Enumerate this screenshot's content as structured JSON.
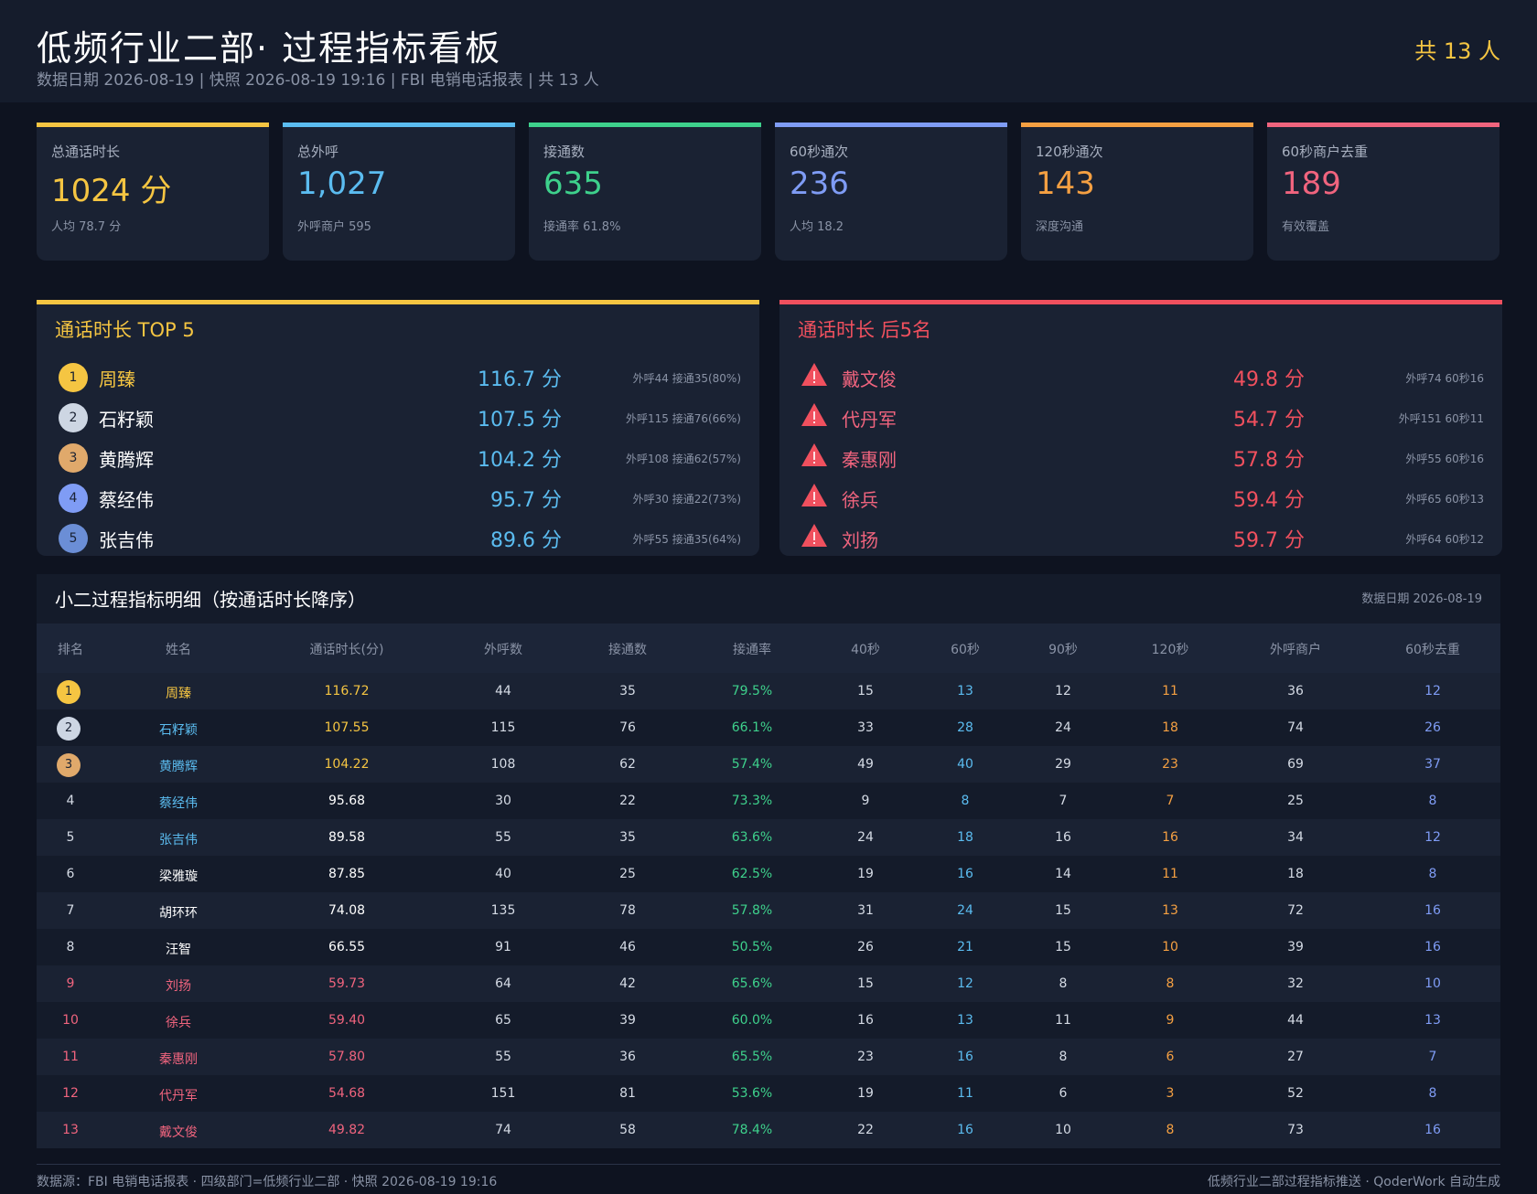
{
  "header": {
    "title": "低频行业二部· 过程指标看板",
    "subtitle": "数据日期 2026-08-19 | 快照 2026-08-19 19:16 | FBI 电销电话报表 | 共 13 人",
    "count": "共 13 人"
  },
  "kpis": [
    {
      "label": "总通话时长",
      "value": "1024 分",
      "note": "人均 78.7 分",
      "color": "#f5c542"
    },
    {
      "label": "总外呼",
      "value": "1,027",
      "note": "外呼商户 595",
      "color": "#5bbcf0"
    },
    {
      "label": "接通数",
      "value": "635",
      "note": "接通率 61.8%",
      "color": "#3ed18c"
    },
    {
      "label": "60秒通次",
      "value": "236",
      "note": "人均 18.2",
      "color": "#7f9cf5"
    },
    {
      "label": "120秒通次",
      "value": "143",
      "note": "深度沟通",
      "color": "#f5a042"
    },
    {
      "label": "60秒商户去重",
      "value": "189",
      "note": "有效覆盖",
      "color": "#f0647e"
    }
  ],
  "top5": {
    "title": "通话时长 TOP 5",
    "color": "#f5c542",
    "rows": [
      {
        "rank": "1",
        "name": "周臻",
        "mins": "116.7 分",
        "meta": "外呼44 接通35(80%)",
        "medal": "#f5c542",
        "namecolor": "#f5c542"
      },
      {
        "rank": "2",
        "name": "石籽颖",
        "mins": "107.5 分",
        "meta": "外呼115 接通76(66%)",
        "medal": "#cdd6e3",
        "namecolor": "#ffffff"
      },
      {
        "rank": "3",
        "name": "黄腾辉",
        "mins": "104.2 分",
        "meta": "外呼108 接通62(57%)",
        "medal": "#e0a96b",
        "namecolor": "#ffffff"
      },
      {
        "rank": "4",
        "name": "蔡经伟",
        "mins": "95.7 分",
        "meta": "外呼30 接通22(73%)",
        "medal": "#7f9cf5",
        "namecolor": "#ffffff"
      },
      {
        "rank": "5",
        "name": "张吉伟",
        "mins": "89.6 分",
        "meta": "外呼55 接通35(64%)",
        "medal": "#6b8ed6",
        "namecolor": "#ffffff"
      }
    ]
  },
  "bottom5": {
    "title": "通话时长 后5名",
    "color": "#f0505e",
    "rows": [
      {
        "name": "戴文俊",
        "mins": "49.8 分",
        "meta": "外呼74 60秒16"
      },
      {
        "name": "代丹军",
        "mins": "54.7 分",
        "meta": "外呼151 60秒11"
      },
      {
        "name": "秦惠刚",
        "mins": "57.8 分",
        "meta": "外呼55 60秒16"
      },
      {
        "name": "徐兵",
        "mins": "59.4 分",
        "meta": "外呼65 60秒13"
      },
      {
        "name": "刘扬",
        "mins": "59.7 分",
        "meta": "外呼64 60秒12"
      }
    ]
  },
  "detail": {
    "title": "小二过程指标明细（按通话时长降序）",
    "date": "数据日期 2026-08-19",
    "columns": [
      "排名",
      "姓名",
      "通话时长(分)",
      "外呼数",
      "接通数",
      "接通率",
      "40秒",
      "60秒",
      "90秒",
      "120秒",
      "外呼商户",
      "60秒去重"
    ],
    "rows": [
      {
        "rank": "1",
        "name": "周臻",
        "mins": "116.72",
        "calls": "44",
        "conn": "35",
        "rate": "79.5%",
        "s40": "15",
        "s60": "13",
        "s90": "12",
        "s120": "11",
        "merch": "36",
        "dedup": "12",
        "tier": "gold"
      },
      {
        "rank": "2",
        "name": "石籽颖",
        "mins": "107.55",
        "calls": "115",
        "conn": "76",
        "rate": "66.1%",
        "s40": "33",
        "s60": "28",
        "s90": "24",
        "s120": "18",
        "merch": "74",
        "dedup": "26",
        "tier": "silver"
      },
      {
        "rank": "3",
        "name": "黄腾辉",
        "mins": "104.22",
        "calls": "108",
        "conn": "62",
        "rate": "57.4%",
        "s40": "49",
        "s60": "40",
        "s90": "29",
        "s120": "23",
        "merch": "69",
        "dedup": "37",
        "tier": "bronze"
      },
      {
        "rank": "4",
        "name": "蔡经伟",
        "mins": "95.68",
        "calls": "30",
        "conn": "22",
        "rate": "73.3%",
        "s40": "9",
        "s60": "8",
        "s90": "7",
        "s120": "7",
        "merch": "25",
        "dedup": "8",
        "tier": "blue"
      },
      {
        "rank": "5",
        "name": "张吉伟",
        "mins": "89.58",
        "calls": "55",
        "conn": "35",
        "rate": "63.6%",
        "s40": "24",
        "s60": "18",
        "s90": "16",
        "s120": "16",
        "merch": "34",
        "dedup": "12",
        "tier": "blue"
      },
      {
        "rank": "6",
        "name": "梁雅璇",
        "mins": "87.85",
        "calls": "40",
        "conn": "25",
        "rate": "62.5%",
        "s40": "19",
        "s60": "16",
        "s90": "14",
        "s120": "11",
        "merch": "18",
        "dedup": "8",
        "tier": "normal"
      },
      {
        "rank": "7",
        "name": "胡环环",
        "mins": "74.08",
        "calls": "135",
        "conn": "78",
        "rate": "57.8%",
        "s40": "31",
        "s60": "24",
        "s90": "15",
        "s120": "13",
        "merch": "72",
        "dedup": "16",
        "tier": "normal"
      },
      {
        "rank": "8",
        "name": "汪智",
        "mins": "66.55",
        "calls": "91",
        "conn": "46",
        "rate": "50.5%",
        "s40": "26",
        "s60": "21",
        "s90": "15",
        "s120": "10",
        "merch": "39",
        "dedup": "16",
        "tier": "normal"
      },
      {
        "rank": "9",
        "name": "刘扬",
        "mins": "59.73",
        "calls": "64",
        "conn": "42",
        "rate": "65.6%",
        "s40": "15",
        "s60": "12",
        "s90": "8",
        "s120": "8",
        "merch": "32",
        "dedup": "10",
        "tier": "low"
      },
      {
        "rank": "10",
        "name": "徐兵",
        "mins": "59.40",
        "calls": "65",
        "conn": "39",
        "rate": "60.0%",
        "s40": "16",
        "s60": "13",
        "s90": "11",
        "s120": "9",
        "merch": "44",
        "dedup": "13",
        "tier": "low"
      },
      {
        "rank": "11",
        "name": "秦惠刚",
        "mins": "57.80",
        "calls": "55",
        "conn": "36",
        "rate": "65.5%",
        "s40": "23",
        "s60": "16",
        "s90": "8",
        "s120": "6",
        "merch": "27",
        "dedup": "7",
        "tier": "low"
      },
      {
        "rank": "12",
        "name": "代丹军",
        "mins": "54.68",
        "calls": "151",
        "conn": "81",
        "rate": "53.6%",
        "s40": "19",
        "s60": "11",
        "s90": "6",
        "s120": "3",
        "merch": "52",
        "dedup": "8",
        "tier": "low"
      },
      {
        "rank": "13",
        "name": "戴文俊",
        "mins": "49.82",
        "calls": "74",
        "conn": "58",
        "rate": "78.4%",
        "s40": "22",
        "s60": "16",
        "s90": "10",
        "s120": "8",
        "merch": "73",
        "dedup": "16",
        "tier": "low"
      }
    ]
  },
  "footer": {
    "left": "数据源：FBI 电销电话报表 · 四级部门=低频行业二部 · 快照 2026-08-19 19:16",
    "right": "低频行业二部过程指标推送 · QoderWork 自动生成"
  },
  "colors": {
    "gold": "#f5c542",
    "silver": "#cdd6e3",
    "bronze": "#e0a96b",
    "blue": "#5bbcf0",
    "green": "#3ed18c",
    "orange": "#f5a042",
    "red": "#f0647e",
    "dedup": "#7f9cf5"
  }
}
